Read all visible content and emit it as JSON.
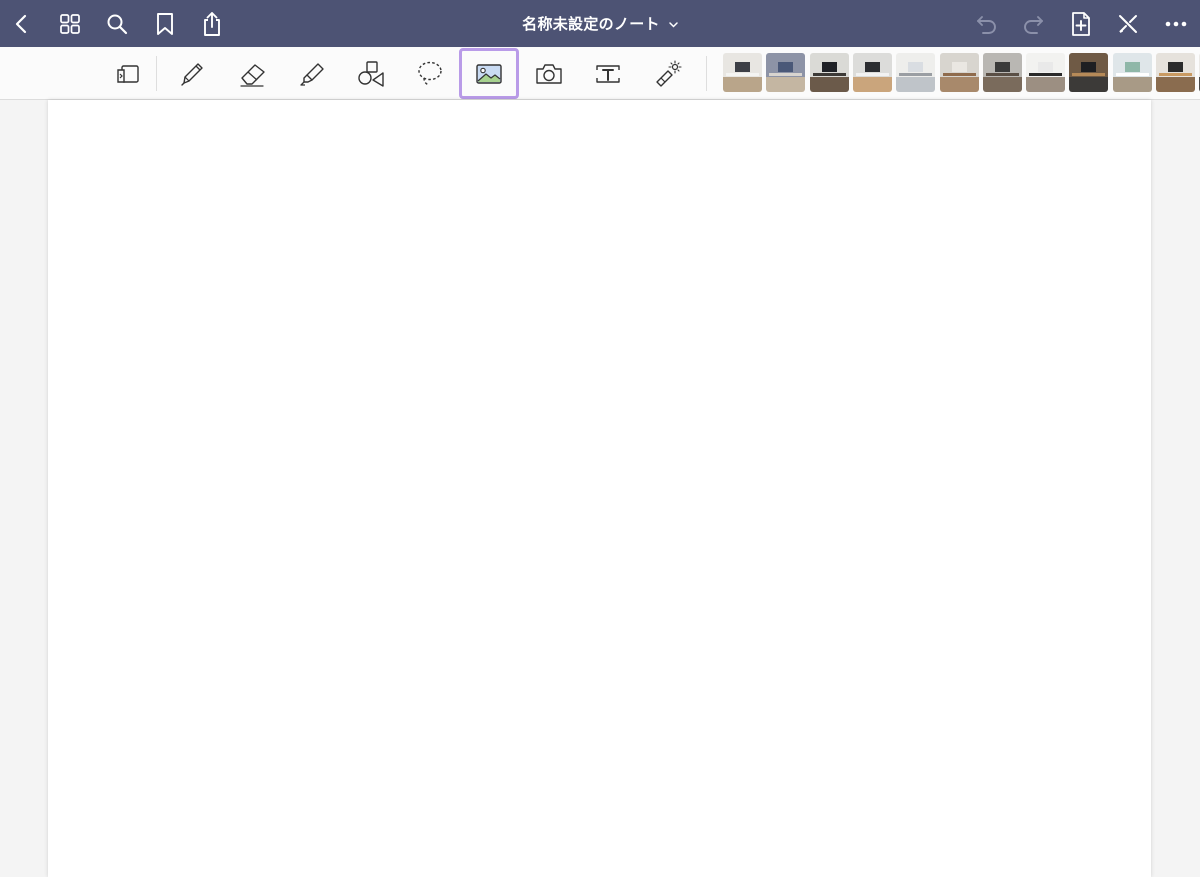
{
  "navbar": {
    "title": "名称未設定のノート",
    "background": "#4d5374"
  },
  "toolbar": {
    "active_tool": "image",
    "active_color": "#b99be8",
    "tools": [
      "page-layout",
      "pen",
      "eraser",
      "highlighter",
      "shapes",
      "lasso",
      "image",
      "camera",
      "text",
      "laser-pointer"
    ]
  },
  "thumbnails": [
    {
      "name": "desk-photo-1",
      "wall": "#e8e6e2",
      "floor": "#b9a58a",
      "desk": "#f4f4f2",
      "screen": "#3d3f46"
    },
    {
      "name": "desk-photo-2",
      "wall": "#8d93a6",
      "floor": "#c4b6a2",
      "desk": "#d8d4cf",
      "screen": "#4a5878"
    },
    {
      "name": "desk-photo-3",
      "wall": "#dadad6",
      "floor": "#6b5a4a",
      "desk": "#3d3a37",
      "screen": "#1f2126"
    },
    {
      "name": "desk-photo-4",
      "wall": "#dcdcda",
      "floor": "#caa57c",
      "desk": "#f2f2f2",
      "screen": "#2b2d31"
    },
    {
      "name": "desk-photo-5",
      "wall": "#eeeeec",
      "floor": "#bfc4c9",
      "desk": "#9a9ea3",
      "screen": "#d9dde2"
    },
    {
      "name": "desk-photo-6",
      "wall": "#d8d5cf",
      "floor": "#a8896b",
      "desk": "#8f6b4c",
      "screen": "#eae7e2"
    },
    {
      "name": "desk-photo-7",
      "wall": "#b9b7b3",
      "floor": "#7a6b5c",
      "desk": "#5a4f45",
      "screen": "#3a3a3a"
    },
    {
      "name": "desk-photo-8",
      "wall": "#f2f2f0",
      "floor": "#9c8f82",
      "desk": "#2a2a2a",
      "screen": "#e9e9e9"
    },
    {
      "name": "desk-photo-9",
      "wall": "#6f5a45",
      "floor": "#3c3a38",
      "desk": "#b68a58",
      "screen": "#1e1f22"
    },
    {
      "name": "desk-photo-10",
      "wall": "#dfe6e9",
      "floor": "#a89a86",
      "desk": "#ffffff",
      "screen": "#8fb7a8"
    },
    {
      "name": "desk-photo-11",
      "wall": "#e6e2dc",
      "floor": "#8a6c4f",
      "desk": "#c99a62",
      "screen": "#2b2b2b"
    },
    {
      "name": "desk-photo-12",
      "wall": "#ebe9e6",
      "floor": "#4a4a4a",
      "desk": "#a0785a",
      "screen": "#303030"
    }
  ]
}
